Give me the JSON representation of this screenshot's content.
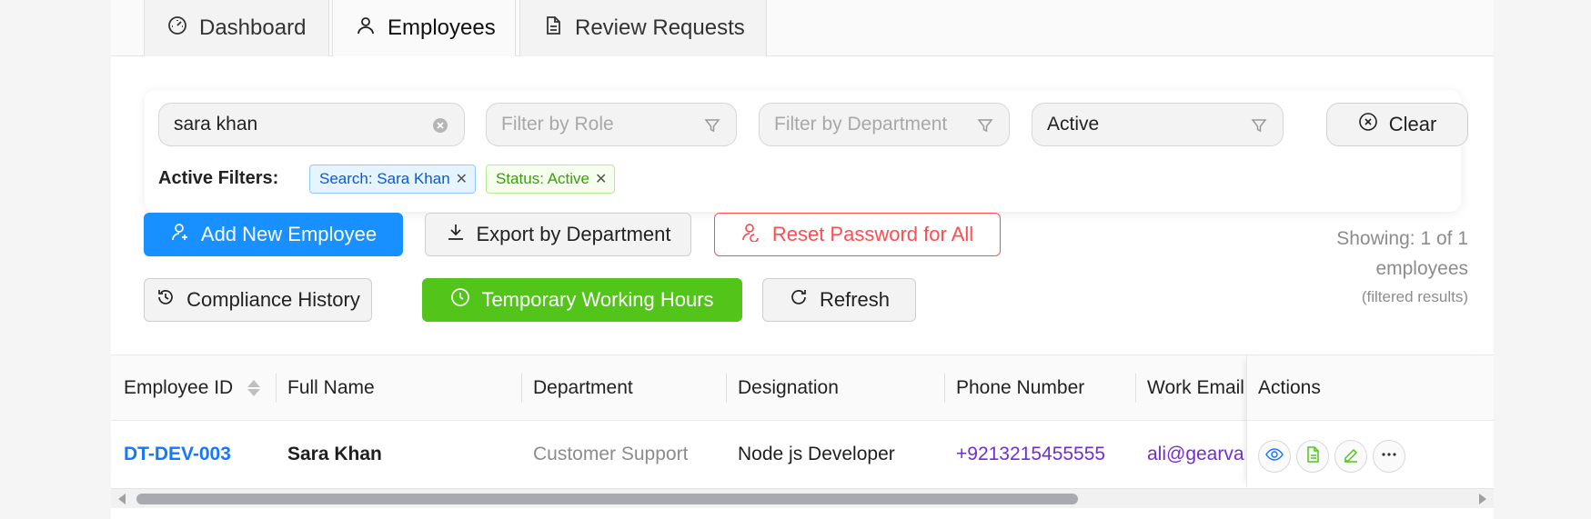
{
  "tabs": [
    {
      "label": "Dashboard",
      "icon": "dashboard-icon"
    },
    {
      "label": "Employees",
      "icon": "user-icon",
      "active": true
    },
    {
      "label": "Review Requests",
      "icon": "document-icon"
    }
  ],
  "filters": {
    "search_value": "sara khan",
    "role_placeholder": "Filter by Role",
    "department_placeholder": "Filter by Department",
    "status_value": "Active",
    "clear_label": "Clear",
    "active_filters_label": "Active Filters:",
    "tags": [
      "Search: Sara Khan",
      "Status: Active"
    ]
  },
  "actions": {
    "add_employee": "Add New Employee",
    "export_department": "Export by Department",
    "reset_password": "Reset Password for All",
    "compliance_history": "Compliance History",
    "temporary_hours": "Temporary Working Hours",
    "refresh": "Refresh"
  },
  "summary": {
    "showing": "Showing: 1 of 1",
    "employees": "employees",
    "filtered": "(filtered results)"
  },
  "table": {
    "columns": [
      "Employee ID",
      "Full Name",
      "Department",
      "Designation",
      "Phone Number",
      "Work Email",
      "Actions"
    ],
    "rows": [
      {
        "employee_id": "DT-DEV-003",
        "full_name": "Sara Khan",
        "department": "Customer Support",
        "designation": "Node js Developer",
        "phone": "+9213215455555",
        "email": "ali@gearvan"
      }
    ]
  },
  "colors": {
    "primary": "#1890ff",
    "success": "#52c41a",
    "danger": "#ff4d4f",
    "link_blue": "#1677ff",
    "purple": "#722ed1",
    "muted": "#8c8c8c"
  }
}
